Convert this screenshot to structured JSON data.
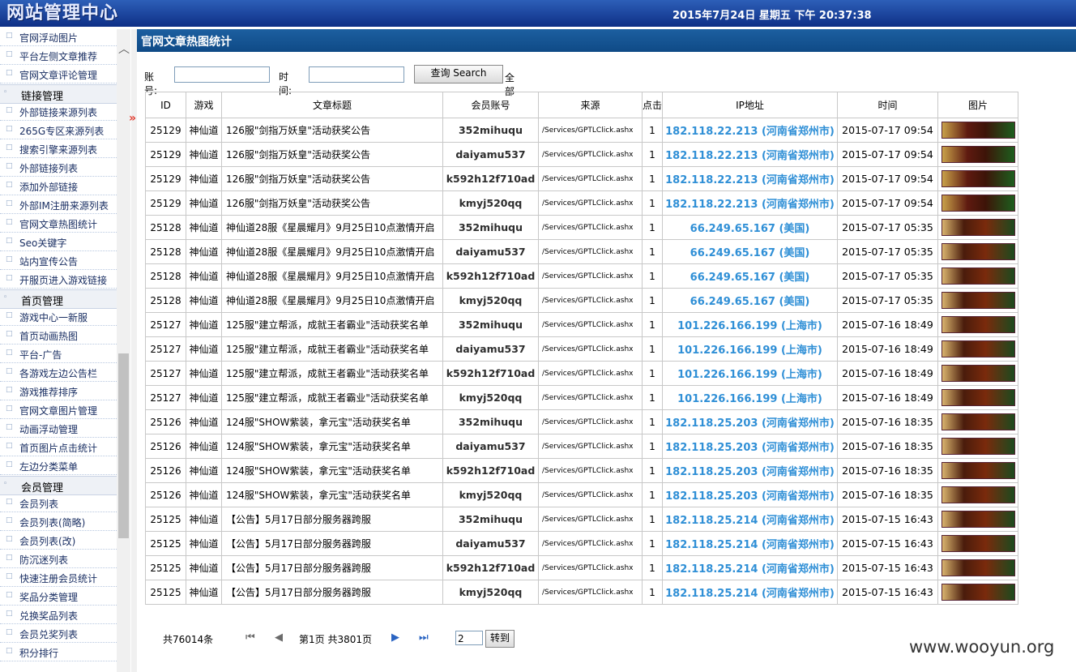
{
  "header": {
    "logo": "网站管理中心",
    "datetime": "2015年7月24日 星期五 下午 20:37:38"
  },
  "sidebar": {
    "entries": [
      {
        "kind": "item",
        "label": "官网浮动图片"
      },
      {
        "kind": "item",
        "label": "平台左侧文章推荐"
      },
      {
        "kind": "item",
        "label": "官网文章评论管理"
      },
      {
        "kind": "cat",
        "label": "链接管理"
      },
      {
        "kind": "item",
        "label": "外部链接来源列表"
      },
      {
        "kind": "item",
        "label": "265G专区来源列表"
      },
      {
        "kind": "item",
        "label": "搜索引擎来源列表"
      },
      {
        "kind": "item",
        "label": "外部链接列表"
      },
      {
        "kind": "item",
        "label": "添加外部链接"
      },
      {
        "kind": "item",
        "label": "外部IM注册来源列表"
      },
      {
        "kind": "item",
        "label": "官网文章热图统计"
      },
      {
        "kind": "item",
        "label": "Seo关键字"
      },
      {
        "kind": "item",
        "label": "站内宣传公告"
      },
      {
        "kind": "item",
        "label": "开服页进入游戏链接"
      },
      {
        "kind": "cat",
        "label": "首页管理"
      },
      {
        "kind": "item",
        "label": "游戏中心一新服"
      },
      {
        "kind": "item",
        "label": "首页动画热图"
      },
      {
        "kind": "item",
        "label": "平台-广告"
      },
      {
        "kind": "item",
        "label": "各游戏左边公告栏"
      },
      {
        "kind": "item",
        "label": "游戏推荐排序"
      },
      {
        "kind": "item",
        "label": "官网文章图片管理"
      },
      {
        "kind": "item",
        "label": "动画浮动管理"
      },
      {
        "kind": "item",
        "label": "首页图片点击统计"
      },
      {
        "kind": "item",
        "label": "左边分类菜单"
      },
      {
        "kind": "cat",
        "label": "会员管理"
      },
      {
        "kind": "item",
        "label": "会员列表"
      },
      {
        "kind": "item",
        "label": "会员列表(简略)"
      },
      {
        "kind": "item",
        "label": "会员列表(改)"
      },
      {
        "kind": "item",
        "label": "防沉迷列表"
      },
      {
        "kind": "item",
        "label": "快速注册会员统计"
      },
      {
        "kind": "item",
        "label": "奖品分类管理"
      },
      {
        "kind": "item",
        "label": "兑换奖品列表"
      },
      {
        "kind": "item",
        "label": "会员兑奖列表"
      },
      {
        "kind": "item",
        "label": "积分排行"
      }
    ]
  },
  "page": {
    "title": "官网文章热图统计"
  },
  "search": {
    "account_label": "账号:",
    "time_label": "时间:",
    "button_label": "查询 Search",
    "all_label": "全部"
  },
  "table": {
    "headers": [
      "ID",
      "游戏",
      "文章标题",
      "会员账号",
      "来源",
      "点击",
      "IP地址",
      "时间",
      "图片"
    ],
    "rows": [
      [
        "25129",
        "神仙道",
        "126服\"剑指万妖皇\"活动获奖公告",
        "352mihuqu",
        "/Services/GPTLClick.ashx",
        "1",
        "182.118.22.213 (河南省郑州市)",
        "2015-07-17 09:54"
      ],
      [
        "25129",
        "神仙道",
        "126服\"剑指万妖皇\"活动获奖公告",
        "daiyamu537",
        "/Services/GPTLClick.ashx",
        "1",
        "182.118.22.213 (河南省郑州市)",
        "2015-07-17 09:54"
      ],
      [
        "25129",
        "神仙道",
        "126服\"剑指万妖皇\"活动获奖公告",
        "k592h12f710ad",
        "/Services/GPTLClick.ashx",
        "1",
        "182.118.22.213 (河南省郑州市)",
        "2015-07-17 09:54"
      ],
      [
        "25129",
        "神仙道",
        "126服\"剑指万妖皇\"活动获奖公告",
        "kmyj520qq",
        "/Services/GPTLClick.ashx",
        "1",
        "182.118.22.213 (河南省郑州市)",
        "2015-07-17 09:54"
      ],
      [
        "25128",
        "神仙道",
        "神仙道28服《星晨耀月》9月25日10点激情开启",
        "352mihuqu",
        "/Services/GPTLClick.ashx",
        "1",
        "66.249.65.167 (美国)",
        "2015-07-17 05:35"
      ],
      [
        "25128",
        "神仙道",
        "神仙道28服《星晨耀月》9月25日10点激情开启",
        "daiyamu537",
        "/Services/GPTLClick.ashx",
        "1",
        "66.249.65.167 (美国)",
        "2015-07-17 05:35"
      ],
      [
        "25128",
        "神仙道",
        "神仙道28服《星晨耀月》9月25日10点激情开启",
        "k592h12f710ad",
        "/Services/GPTLClick.ashx",
        "1",
        "66.249.65.167 (美国)",
        "2015-07-17 05:35"
      ],
      [
        "25128",
        "神仙道",
        "神仙道28服《星晨耀月》9月25日10点激情开启",
        "kmyj520qq",
        "/Services/GPTLClick.ashx",
        "1",
        "66.249.65.167 (美国)",
        "2015-07-17 05:35"
      ],
      [
        "25127",
        "神仙道",
        "125服\"建立帮派，成就王者霸业\"活动获奖名单",
        "352mihuqu",
        "/Services/GPTLClick.ashx",
        "1",
        "101.226.166.199 (上海市)",
        "2015-07-16 18:49"
      ],
      [
        "25127",
        "神仙道",
        "125服\"建立帮派，成就王者霸业\"活动获奖名单",
        "daiyamu537",
        "/Services/GPTLClick.ashx",
        "1",
        "101.226.166.199 (上海市)",
        "2015-07-16 18:49"
      ],
      [
        "25127",
        "神仙道",
        "125服\"建立帮派，成就王者霸业\"活动获奖名单",
        "k592h12f710ad",
        "/Services/GPTLClick.ashx",
        "1",
        "101.226.166.199 (上海市)",
        "2015-07-16 18:49"
      ],
      [
        "25127",
        "神仙道",
        "125服\"建立帮派，成就王者霸业\"活动获奖名单",
        "kmyj520qq",
        "/Services/GPTLClick.ashx",
        "1",
        "101.226.166.199 (上海市)",
        "2015-07-16 18:49"
      ],
      [
        "25126",
        "神仙道",
        "124服\"SHOW紫装，拿元宝\"活动获奖名单",
        "352mihuqu",
        "/Services/GPTLClick.ashx",
        "1",
        "182.118.25.203 (河南省郑州市)",
        "2015-07-16 18:35"
      ],
      [
        "25126",
        "神仙道",
        "124服\"SHOW紫装，拿元宝\"活动获奖名单",
        "daiyamu537",
        "/Services/GPTLClick.ashx",
        "1",
        "182.118.25.203 (河南省郑州市)",
        "2015-07-16 18:35"
      ],
      [
        "25126",
        "神仙道",
        "124服\"SHOW紫装，拿元宝\"活动获奖名单",
        "k592h12f710ad",
        "/Services/GPTLClick.ashx",
        "1",
        "182.118.25.203 (河南省郑州市)",
        "2015-07-16 18:35"
      ],
      [
        "25126",
        "神仙道",
        "124服\"SHOW紫装，拿元宝\"活动获奖名单",
        "kmyj520qq",
        "/Services/GPTLClick.ashx",
        "1",
        "182.118.25.203 (河南省郑州市)",
        "2015-07-16 18:35"
      ],
      [
        "25125",
        "神仙道",
        "【公告】5月17日部分服务器跨服",
        "352mihuqu",
        "/Services/GPTLClick.ashx",
        "1",
        "182.118.25.214 (河南省郑州市)",
        "2015-07-15 16:43"
      ],
      [
        "25125",
        "神仙道",
        "【公告】5月17日部分服务器跨服",
        "daiyamu537",
        "/Services/GPTLClick.ashx",
        "1",
        "182.118.25.214 (河南省郑州市)",
        "2015-07-15 16:43"
      ],
      [
        "25125",
        "神仙道",
        "【公告】5月17日部分服务器跨服",
        "k592h12f710ad",
        "/Services/GPTLClick.ashx",
        "1",
        "182.118.25.214 (河南省郑州市)",
        "2015-07-15 16:43"
      ],
      [
        "25125",
        "神仙道",
        "【公告】5月17日部分服务器跨服",
        "kmyj520qq",
        "/Services/GPTLClick.ashx",
        "1",
        "182.118.25.214 (河南省郑州市)",
        "2015-07-15 16:43"
      ]
    ]
  },
  "pager": {
    "total": "共76014条",
    "page_info": "第1页 共3801页",
    "page_input": "2",
    "go_label": "转到"
  },
  "watermark": "www.wooyun.org",
  "colors": {
    "header": "#0e2f86",
    "titlebar": "#0f4a86",
    "ip_link": "#2f8fd6"
  }
}
